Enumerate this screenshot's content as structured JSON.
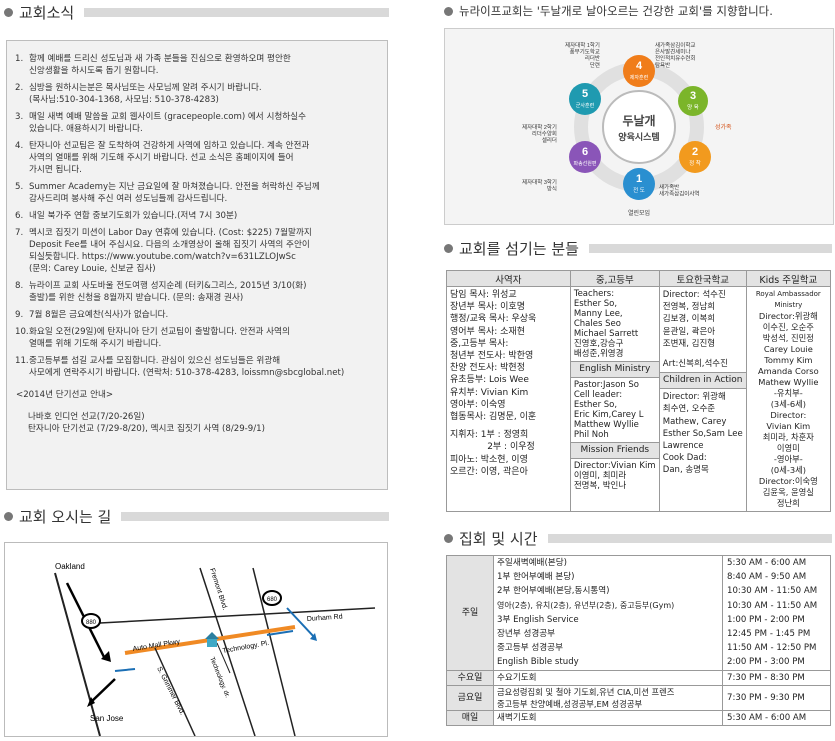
{
  "sections": {
    "news": "교회소식",
    "directions": "교회 오시는 길",
    "staff": "교회를 섬기는 분들",
    "services": "집회 및 시간",
    "vision": "뉴라이프교회는 '두날개로 날아오르는 건강한 교회'를 지향합니다."
  },
  "notices": [
    {
      "num": "1.",
      "text": "함께 예배를 드리신 성도님과 새 가족 분들을 진심으로 환영하오며 평안한\n신앙생활을 하시도록 돕기 원합니다."
    },
    {
      "num": "2.",
      "text": "심방을 원하시는분은 목사님또는 사모님께 알려 주시기 바랍니다.\n(목사님:510-304-1368, 사모님: 510-378-4283)"
    },
    {
      "num": "3.",
      "text": "매일 새벽 예배 말씀을 교회 웹사이트 (gracepeople.com) 에서 시청하실수\n있습니다. 애용하시기 바랍니다."
    },
    {
      "num": "4.",
      "text": "탄자니아 선교팀은 잘 도착하여 건강하게 사역에 임하고 있습니다. 계속 안전과\n사역의 열매를 위해 기도해 주시기 바랍니다. 선교 소식은 홈페이지에 들어\n가시면 됩니다."
    },
    {
      "num": "5.",
      "text": "Summer Academy는 지난 금요일에 잘 마쳐졌습니다. 안전을 허락하신 주님께\n감사드리며 봉사해 주신 여러 성도님들께 감사드립니다."
    },
    {
      "num": "6.",
      "text": "내일 북가주 연합 중보기도회가 있습니다.(저녁 7시 30분)"
    },
    {
      "num": "7.",
      "text": "멕시코 집짓기 미션이 Labor Day 연휴에 있습니다. (Cost: $225) 7월말까지\nDeposit Fee를 내어 주십시요. 다음의 소개영상이 올해 집짓기 사역의 주안이\n되실듯합니다. https://www.youtube.com/watch?v=631LZLOJwSc\n(문의: Carey Louie, 신보균 집사)"
    },
    {
      "num": "8.",
      "text": "뉴라이프 교회 사도바울 전도여행 성지순례 (터키&그리스, 2015년 3/10(화)\n출발)를 위한 신청을 8월까지 받습니다. (문의: 송재경 권사)"
    },
    {
      "num": "9.",
      "text": "7월 8월은 금요예찬(식사)가 없습니다."
    },
    {
      "num": "10.",
      "text": "화요일 오전(29일)에 탄자니아 단기 선교팀이 출발합니다. 안전과 사역의\n열매를 위해 기도해 주시기 바랍니다."
    },
    {
      "num": "11.",
      "text": "중고등부를 섬길 교사를 모집합니다. 관심이 있으신 성도님들은 위광해\n사모에게 연락주시기 바랍니다. (연락처: 510-378-4283, loissmn@sbcglobal.net)"
    }
  ],
  "mission": {
    "title": "<2014년 단기선교 안내>",
    "line1": "나바호 인디언 선교(7/20-26일)",
    "line2": "탄자니아 단기선교 (7/29-8/20), 멕시코 집짓기 사역 (8/29-9/1)"
  },
  "map": {
    "oakland": "Oakland",
    "san_jose": "San Jose",
    "fremont": "Fremont Blvd.",
    "auto_mall": "Auto Mall Pkwy",
    "durham": "Durham Rd",
    "grimmer": "S. Grimmer Blvd.",
    "technology_dr": "Technology. dr.",
    "technology_pl": "Technology. Pl.",
    "hwy880": "880",
    "hwy680": "680"
  },
  "diagram": {
    "center1": "두날개",
    "center2": "양육시스템",
    "n1": "1",
    "n1_label": "전 도",
    "n1_text": "새가족반\n새가족삼김이사역",
    "n1_bottom": "열린모임",
    "n2": "2",
    "n2_label": "정 착",
    "n2_text": "",
    "n3": "3",
    "n3_label": "양 육",
    "n3_text": "성가족",
    "n4": "4",
    "n4_label": "제자훈련",
    "n4_text": "제자대학 1학기\n풍부기도학교\n리더반\n단련",
    "n4_right": "새가족삼김이학교\n은사발견세미나\n전인적치유수련회\n탐욕반",
    "n5": "5",
    "n5_label": "군사훈련",
    "n5_text": "제자대학 2학기\n리더수양회\n셀리더",
    "n6": "6",
    "n6_label": "파송선원편",
    "n6_text": "제자대학 3학기\n방식"
  },
  "staff": {
    "headers": [
      "사역자",
      "중,고등부",
      "토요한국학교",
      "Kids 주일학교"
    ],
    "col1": [
      "담임 목사: 위성교",
      "장년부 목사: 이호명",
      "행정/교육 목사: 우상욱",
      "영어부 목사: 소재현",
      "중,고등부 목사:",
      "청년부 전도사: 박한영",
      "찬양 전도사: 박현정",
      "유초등부: Lois Wee",
      "유치부: Vivian Kim",
      "영아부: 이숙영",
      "협동목사: 김명문, 이훈",
      "",
      "지휘자: 1부 : 정영희",
      "             2부 : 이우정",
      "피아노: 박소현, 이영",
      "오르간: 이영, 곽은아"
    ],
    "col2a": [
      "Teachers:",
      "Esther So,",
      "Manny Lee,",
      "Chales Seo",
      "Michael Sarrett",
      "진영호,강승구",
      "배성준,위영경"
    ],
    "col2_sub1": "English Ministry",
    "col2b": [
      "Pastor:Jason So",
      "Cell leader:",
      "Esther So,",
      "Eric Kim,Carey L",
      "Matthew Wyllie",
      "Phil Noh"
    ],
    "col2_sub2": "Mission Friends",
    "col2c": [
      "Director:Vivian Kim",
      "이영미, 최미라",
      "전명복, 박인나"
    ],
    "col3a": [
      "Director: 석수진",
      "전영복, 정남희",
      "김보경, 이복희",
      "윤관일, 곽은아",
      "조변재, 김진형",
      "",
      "Art:신복희,석수진"
    ],
    "col3_sub": "Children in Action",
    "col3b": [
      "Director: 위광해",
      "최수연, 오수준",
      "Mathew, Carey",
      "Esther So,Sam Lee",
      "Lawrence",
      "Cook Dad:",
      "Dan, 송명목"
    ],
    "col4": [
      "Royal Ambassador",
      "Ministry",
      "Director:위광해",
      "이수진, 오순주",
      "박성석, 진민정",
      "Carey Louie",
      "Tommy Kim",
      "Amanda Corso",
      "Mathew Wyllie",
      "-유치부-",
      "(3세-6세)",
      "Director:",
      "Vivian Kim",
      "최미라, 차훈자",
      "이영미",
      "-영아부-",
      "(0세-3세)",
      "Director:이숙영",
      "김윤옥, 윤영실",
      "정난희"
    ]
  },
  "services": [
    {
      "cat": "주일",
      "items": [
        {
          "name": "주일새벽예배(본당)",
          "time": "5:30 AM - 6:00 AM"
        },
        {
          "name": "1부 한어부예배 본당)",
          "time": "8:40 AM - 9:50 AM"
        },
        {
          "name": "2부 한어부예배(본당,동시통역)",
          "time": "10:30 AM - 11:50 AM"
        },
        {
          "name": "영아(2층), 유치(2층), 유년부(2층), 중고등부(Gym)",
          "time": "10:30 AM - 11:50 AM"
        },
        {
          "name": "3부 English Service",
          "time": "1:00 PM - 2:00 PM"
        },
        {
          "name": "장년부 성경공부",
          "time": "12:45 PM - 1:45 PM"
        },
        {
          "name": "중고등부 성경공부",
          "time": "11:50 AM - 12:50 PM"
        },
        {
          "name": "English Bible study",
          "time": "2:00 PM - 3:00 PM"
        }
      ]
    },
    {
      "cat": "수요일",
      "items": [
        {
          "name": "수요기도회",
          "time": "7:30 PM - 8:30 PM"
        }
      ]
    },
    {
      "cat": "금요일",
      "items": [
        {
          "name": "금요성령집회 및 철야 기도회,유년 CIA,미션 프렌즈\n중고등부 찬양예배,성경공부,EM 성경공부",
          "time": "7:30 PM - 9:30 PM"
        }
      ]
    },
    {
      "cat": "매일",
      "items": [
        {
          "name": "새벽기도회",
          "time": "5:30 AM - 6:00 AM"
        }
      ]
    }
  ]
}
